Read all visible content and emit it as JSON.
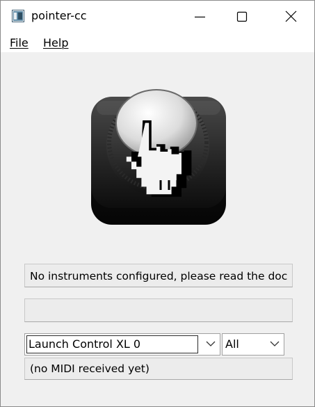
{
  "window": {
    "title": "pointer-cc"
  },
  "menu": {
    "file_label": "File",
    "help_label": "Help"
  },
  "status": {
    "message": "No instruments configured, please read the doc",
    "secondary_message": ""
  },
  "midi": {
    "device_selected": "Launch Control XL 0",
    "channel_selected": "All",
    "last_message": "(no MIDI received yet)"
  },
  "icons": {
    "app": "app-window-icon",
    "minimize": "minimize-icon",
    "maximize": "maximize-icon",
    "close": "close-icon",
    "logo": "knob-pointer-hand-logo",
    "dropdown": "chevron-down-icon"
  }
}
